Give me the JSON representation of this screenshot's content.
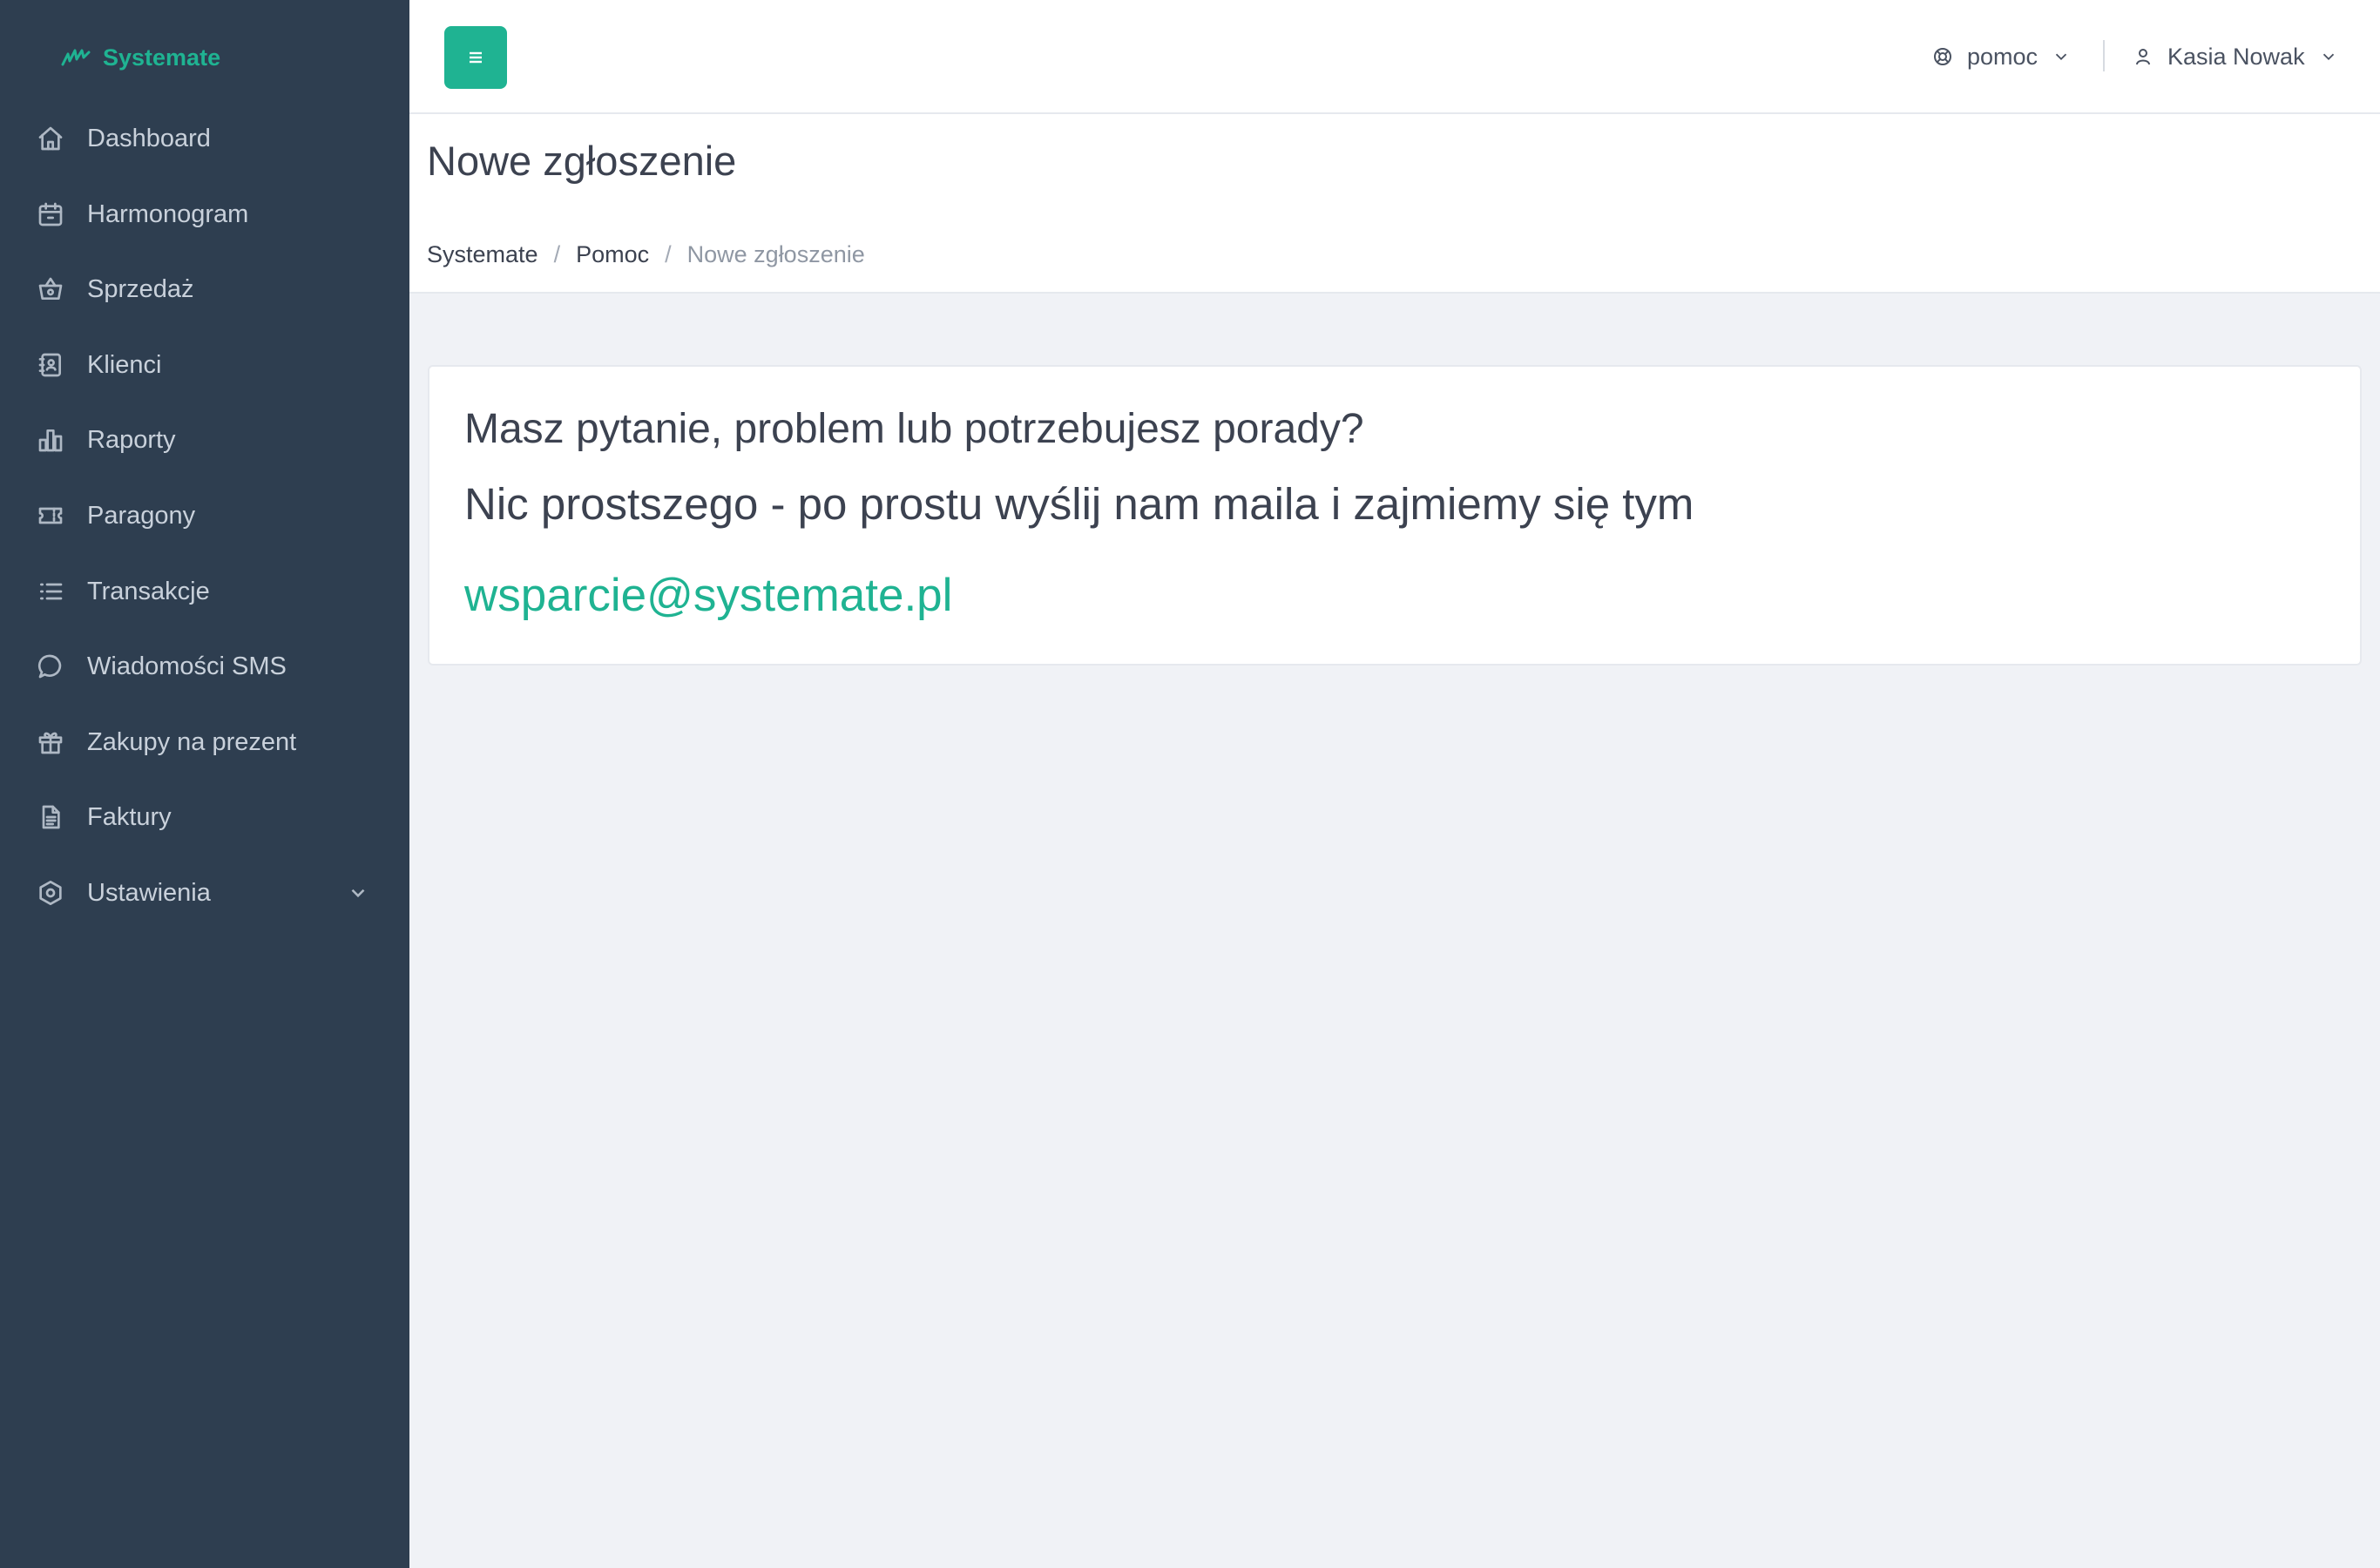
{
  "brand": {
    "name": "Systemate",
    "accent_color": "#1fb392"
  },
  "sidebar": {
    "background": "#2e3e50",
    "items": [
      {
        "label": "Dashboard",
        "icon": "home-icon"
      },
      {
        "label": "Harmonogram",
        "icon": "calendar-icon"
      },
      {
        "label": "Sprzedaż",
        "icon": "basket-icon"
      },
      {
        "label": "Klienci",
        "icon": "contacts-icon"
      },
      {
        "label": "Raporty",
        "icon": "bar-chart-icon"
      },
      {
        "label": "Paragony",
        "icon": "ticket-icon"
      },
      {
        "label": "Transakcje",
        "icon": "list-icon"
      },
      {
        "label": "Wiadomości SMS",
        "icon": "message-icon"
      },
      {
        "label": "Zakupy na prezent",
        "icon": "gift-icon"
      },
      {
        "label": "Faktury",
        "icon": "document-icon"
      },
      {
        "label": "Ustawienia",
        "icon": "settings-hexagon-icon",
        "has_submenu": true
      }
    ]
  },
  "topbar": {
    "menu_icon": "hamburger-icon",
    "help_label": "pomoc",
    "user_name": "Kasia Nowak"
  },
  "page": {
    "title": "Nowe zgłoszenie",
    "breadcrumb": [
      "Systemate",
      "Pomoc",
      "Nowe zgłoszenie"
    ]
  },
  "card": {
    "question": "Masz pytanie, problem lub potrzebujesz porady?",
    "lead": "Nic prostszego - po prostu wyślij nam maila i zajmiemy się tym",
    "email": "wsparcie@systemate.pl"
  }
}
